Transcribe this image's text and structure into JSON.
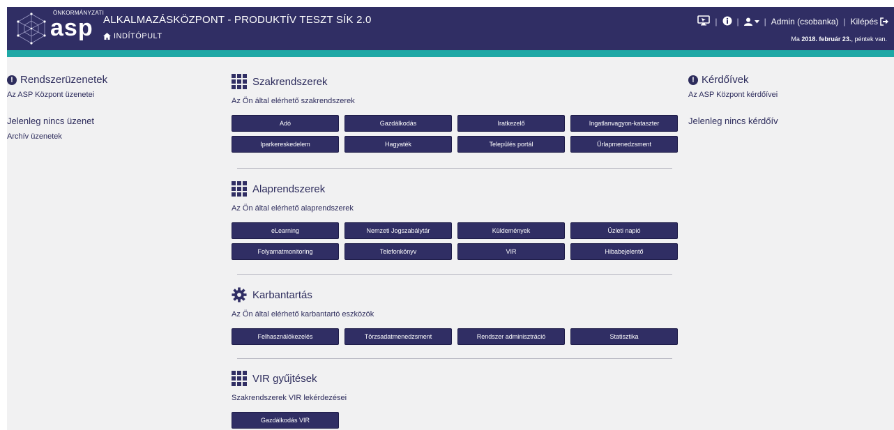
{
  "header": {
    "logo_small": "ÖNKORMÁNYZATI",
    "logo_big": "asp",
    "app_title": "ALKALMAZÁSKÖZPONT - PRODUKTÍV TESZT SÍK 2.0",
    "home_label": "INDÍTÓPULT",
    "user_label": "Admin (csobanka)",
    "logout_label": "Kilépés",
    "date_prefix": "Ma",
    "date_bold": "2018. február 23.",
    "date_suffix": ", péntek van."
  },
  "left": {
    "title": "Rendszerüzenetek",
    "subtitle": "Az ASP Központ üzenetei",
    "empty": "Jelenleg nincs üzenet",
    "archive_link": "Archív üzenetek"
  },
  "right": {
    "title": "Kérdőívek",
    "subtitle": "Az ASP Központ kérdőívei",
    "empty": "Jelenleg nincs kérdőív"
  },
  "sections": [
    {
      "title": "Szakrendszerek",
      "subtitle": "Az Ön által elérhető szakrendszerek",
      "buttons": [
        "Adó",
        "Gazdálkodás",
        "Iratkezelő",
        "Ingatlanvagyon-kataszter",
        "Iparkereskedelem",
        "Hagyaték",
        "Település portál",
        "Űrlapmenedzsment"
      ]
    },
    {
      "title": "Alaprendszerek",
      "subtitle": "Az Ön által elérhető alaprendszerek",
      "buttons": [
        "eLearning",
        "Nemzeti Jogszabálytár",
        "Küldemények",
        "Üzleti napió",
        "Folyamatmonitoring",
        "Telefonkönyv",
        "VIR",
        "Hibabejelentő"
      ]
    },
    {
      "title": "Karbantartás",
      "subtitle": "Az Ön által elérhető karbantartó eszközök",
      "buttons": [
        "Felhasználókezelés",
        "Törzsadatmenedzsment",
        "Rendszer adminisztráció",
        "Statisztika"
      ]
    },
    {
      "title": "VIR gyűjtések",
      "subtitle": "Szakrendszerek VIR lekérdezései",
      "buttons": [
        "Gazdálkodás VIR"
      ]
    }
  ],
  "colors": {
    "header_bg": "#302e64",
    "accent_teal": "#1fa8a6",
    "button_bg": "#302e64",
    "page_bg": "#f1f1f2"
  },
  "icons": {
    "home": "home-icon",
    "monitor": "monitor-icon",
    "info": "info-icon",
    "user": "user-icon",
    "logout": "logout-icon",
    "alert": "exclamation-icon",
    "grid": "grid-icon",
    "gear": "gear-icon"
  }
}
